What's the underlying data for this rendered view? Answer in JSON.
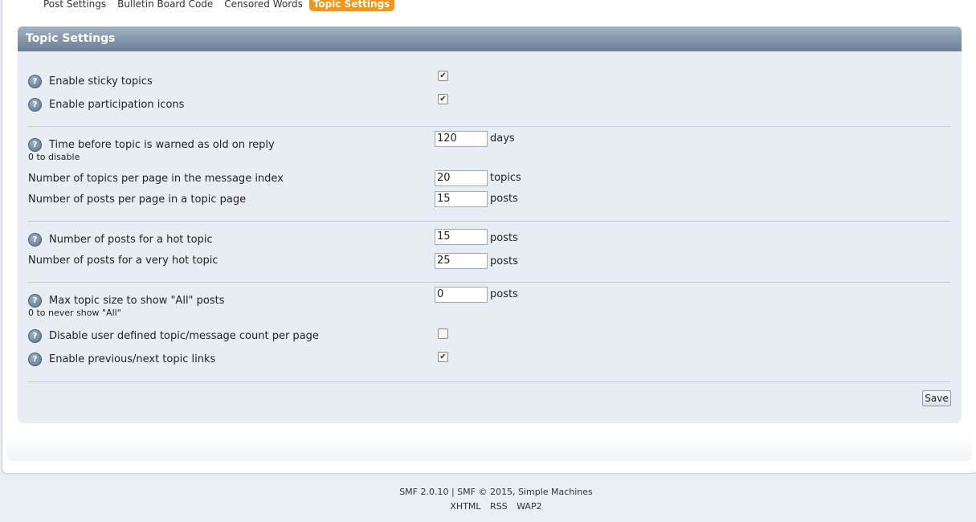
{
  "tabs": [
    "Post Settings",
    "Bulletin Board Code",
    "Censored Words",
    "Topic Settings"
  ],
  "active_tab": "Topic Settings",
  "section_title": "Topic Settings",
  "settings": {
    "sticky": {
      "label": "Enable sticky topics",
      "checked": true
    },
    "participation": {
      "label": "Enable participation icons",
      "checked": true
    },
    "old_warn": {
      "label": "Time before topic is warned as old on reply",
      "sub": "0 to disable",
      "value": "120",
      "unit": "days"
    },
    "topics_per_page": {
      "label": "Number of topics per page in the message index",
      "value": "20",
      "unit": "topics"
    },
    "posts_per_page": {
      "label": "Number of posts per page in a topic page",
      "value": "15",
      "unit": "posts"
    },
    "hot_topic": {
      "label": "Number of posts for a hot topic",
      "value": "15",
      "unit": "posts"
    },
    "very_hot_topic": {
      "label": "Number of posts for a very hot topic",
      "value": "25",
      "unit": "posts"
    },
    "max_all": {
      "label": "Max topic size to show \"All\" posts",
      "sub": "0 to never show \"All\"",
      "value": "0",
      "unit": "posts"
    },
    "disable_user_count": {
      "label": "Disable user defined topic/message count per page",
      "checked": false
    },
    "prev_next": {
      "label": "Enable previous/next topic links",
      "checked": true
    }
  },
  "save_label": "Save",
  "footer": {
    "copyright": "SMF 2.0.10 | SMF © 2015, Simple Machines",
    "links": [
      "XHTML",
      "RSS",
      "WAP2"
    ]
  }
}
